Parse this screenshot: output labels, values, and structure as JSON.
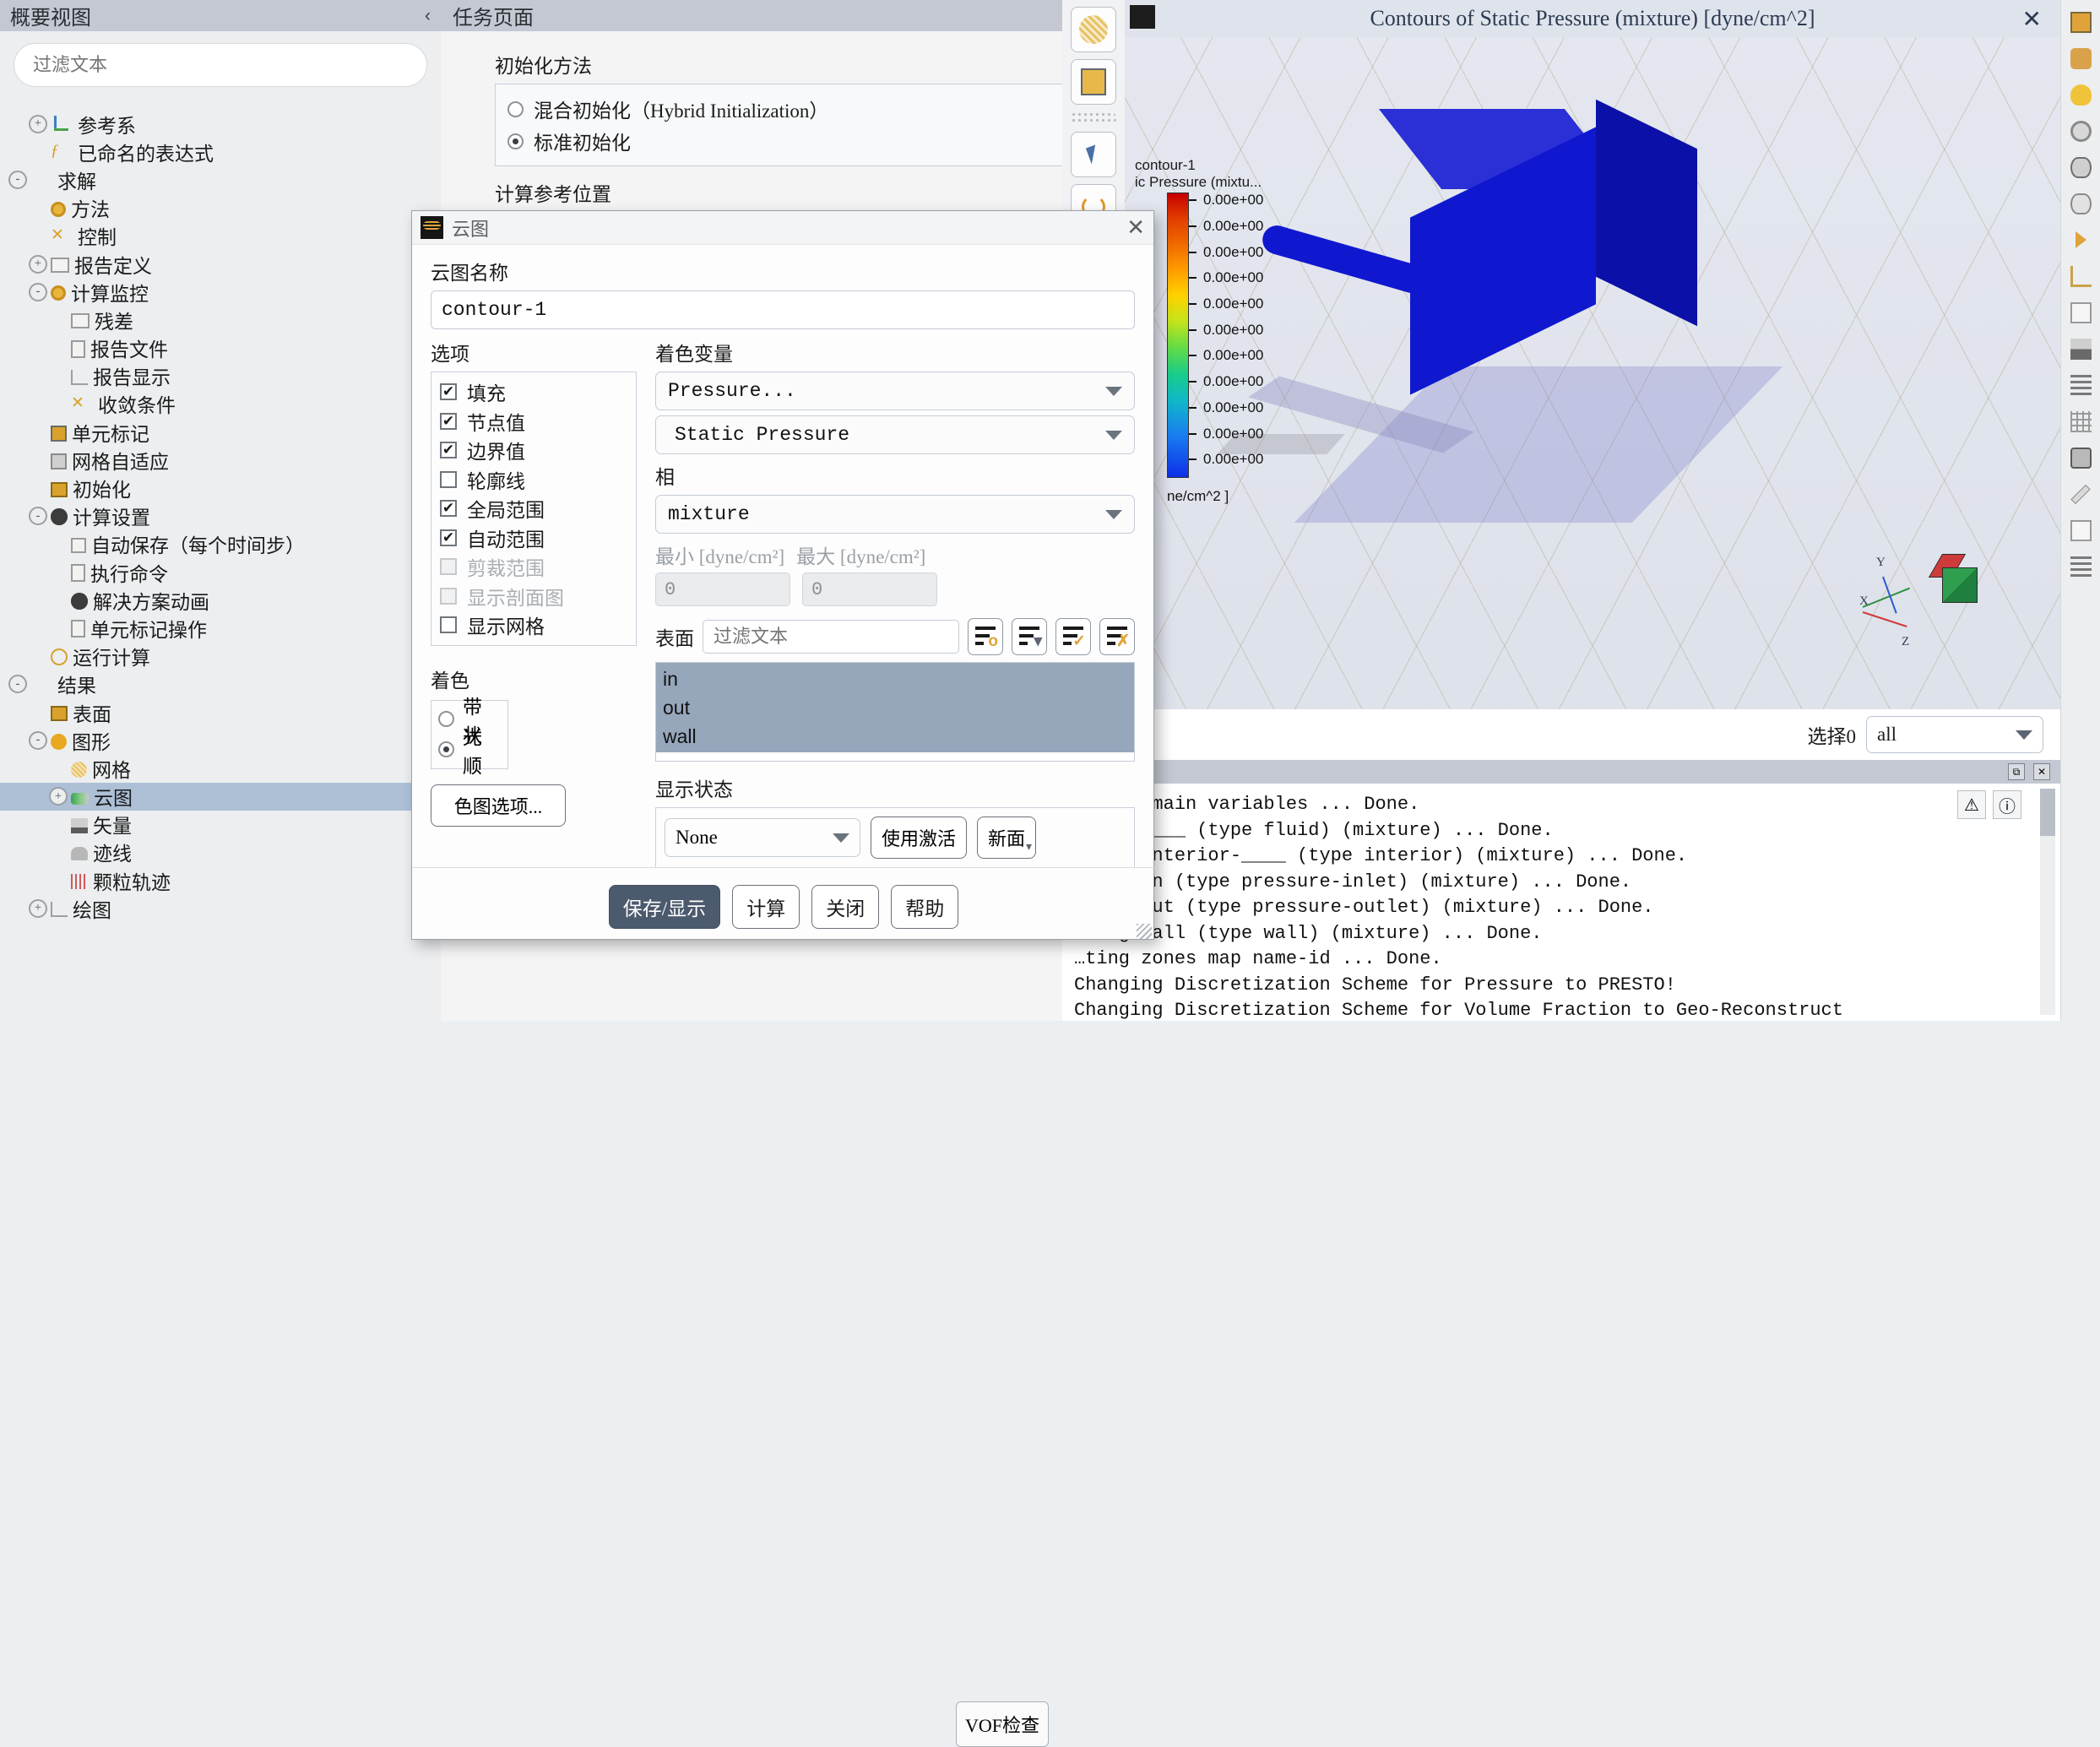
{
  "sidebar": {
    "header_title": "概要视图",
    "collapse_icon": "‹",
    "filter_placeholder": "过滤文本",
    "tree": [
      {
        "label": "参考系",
        "indent": 1,
        "twist": "+",
        "icon": "axes-icon",
        "sel": false
      },
      {
        "label": "已命名的表达式",
        "indent": 1,
        "twist": "",
        "icon": "function-icon",
        "sel": false
      },
      {
        "label": "求解",
        "indent": 0,
        "twist": "-",
        "icon": "",
        "sel": false
      },
      {
        "label": "方法",
        "indent": 1,
        "twist": "",
        "icon": "methods-icon",
        "sel": false
      },
      {
        "label": "控制",
        "indent": 1,
        "twist": "",
        "icon": "controls-icon",
        "sel": false
      },
      {
        "label": "报告定义",
        "indent": 1,
        "twist": "+",
        "icon": "report-definition-icon",
        "sel": false
      },
      {
        "label": "计算监控",
        "indent": 1,
        "twist": "-",
        "icon": "monitor-icon",
        "sel": false
      },
      {
        "label": "残差",
        "indent": 2,
        "twist": "",
        "icon": "residual-icon",
        "sel": false
      },
      {
        "label": "报告文件",
        "indent": 2,
        "twist": "",
        "icon": "report-file-icon",
        "sel": false
      },
      {
        "label": "报告显示",
        "indent": 2,
        "twist": "",
        "icon": "report-plot-icon",
        "sel": false
      },
      {
        "label": "收敛条件",
        "indent": 2,
        "twist": "",
        "icon": "convergence-icon",
        "sel": false
      },
      {
        "label": "单元标记",
        "indent": 1,
        "twist": "",
        "icon": "cell-register-icon",
        "sel": false
      },
      {
        "label": "网格自适应",
        "indent": 1,
        "twist": "",
        "icon": "adapt-icon",
        "sel": false
      },
      {
        "label": "初始化",
        "indent": 1,
        "twist": "",
        "icon": "initialize-icon",
        "sel": false
      },
      {
        "label": "计算设置",
        "indent": 1,
        "twist": "-",
        "icon": "calc-settings-icon",
        "sel": false
      },
      {
        "label": "自动保存（每个时间步）",
        "indent": 2,
        "twist": "",
        "icon": "autosave-icon",
        "sel": false
      },
      {
        "label": "执行命令",
        "indent": 2,
        "twist": "",
        "icon": "execute-command-icon",
        "sel": false
      },
      {
        "label": "解决方案动画",
        "indent": 2,
        "twist": "",
        "icon": "animation-icon",
        "sel": false
      },
      {
        "label": "单元标记操作",
        "indent": 2,
        "twist": "",
        "icon": "cell-register-ops-icon",
        "sel": false
      },
      {
        "label": "运行计算",
        "indent": 1,
        "twist": "",
        "icon": "run-calculation-icon",
        "sel": false
      },
      {
        "label": "结果",
        "indent": 0,
        "twist": "-",
        "icon": "",
        "sel": false
      },
      {
        "label": "表面",
        "indent": 1,
        "twist": "",
        "icon": "surfaces-icon",
        "sel": false
      },
      {
        "label": "图形",
        "indent": 1,
        "twist": "-",
        "icon": "graphics-icon",
        "sel": false
      },
      {
        "label": "网格",
        "indent": 2,
        "twist": "",
        "icon": "mesh-icon",
        "sel": false
      },
      {
        "label": "云图",
        "indent": 2,
        "twist": "+",
        "icon": "contours-icon",
        "sel": true
      },
      {
        "label": "矢量",
        "indent": 2,
        "twist": "",
        "icon": "vectors-icon",
        "sel": false
      },
      {
        "label": "迹线",
        "indent": 2,
        "twist": "",
        "icon": "pathlines-icon",
        "sel": false
      },
      {
        "label": "颗粒轨迹",
        "indent": 2,
        "twist": "",
        "icon": "particle-tracks-icon",
        "sel": false
      },
      {
        "label": "绘图",
        "indent": 1,
        "twist": "+",
        "icon": "plots-icon",
        "sel": false
      }
    ]
  },
  "taskpage": {
    "header_title": "任务页面",
    "collapse_icon": "‹",
    "init_method_label": "初始化方法",
    "init_options": [
      {
        "label": "混合初始化（Hybrid Initialization）",
        "selected": false
      },
      {
        "label": "标准初始化",
        "selected": true
      }
    ],
    "reference_label": "计算参考位置",
    "reference_value": "",
    "vof_check_label": "VOF检查"
  },
  "dialog": {
    "title": "云图",
    "close_icon": "✕",
    "name_label": "云图名称",
    "name_value": "contour-1",
    "options_label": "选项",
    "options": [
      {
        "label": "填充",
        "checked": true,
        "disabled": false
      },
      {
        "label": "节点值",
        "checked": true,
        "disabled": false
      },
      {
        "label": "边界值",
        "checked": true,
        "disabled": false
      },
      {
        "label": "轮廓线",
        "checked": false,
        "disabled": false
      },
      {
        "label": "全局范围",
        "checked": true,
        "disabled": false
      },
      {
        "label": "自动范围",
        "checked": true,
        "disabled": false
      },
      {
        "label": "剪裁范围",
        "checked": false,
        "disabled": true
      },
      {
        "label": "显示剖面图",
        "checked": false,
        "disabled": true
      },
      {
        "label": "显示网格",
        "checked": false,
        "disabled": false
      }
    ],
    "coloring_label": "着色",
    "coloring_options": [
      {
        "label": "带状",
        "selected": false
      },
      {
        "label": "光顺",
        "selected": true
      }
    ],
    "colormap_button": "色图选项...",
    "color_by_label": "着色变量",
    "color_by_value": "Pressure...",
    "color_by_sub_value": "Static Pressure",
    "phase_label": "相",
    "phase_value": "mixture",
    "min_label": "最小 [dyne/cm²]",
    "max_label": "最大 [dyne/cm²]",
    "min_value": "0",
    "max_value": "0",
    "surfaces_label": "表面",
    "surfaces_filter_placeholder": "过滤文本",
    "surface_buttons": [
      "match-surfaces-icon",
      "select-filter-icon",
      "select-all-icon",
      "deselect-all-icon"
    ],
    "surfaces": [
      "in",
      "out",
      "wall"
    ],
    "display_state_label": "显示状态",
    "display_state_value": "None",
    "use_active_button": "使用激活",
    "new_surface_button": "新面",
    "buttons": [
      {
        "label": "保存/显示",
        "primary": true
      },
      {
        "label": "计算",
        "primary": false
      },
      {
        "label": "关闭",
        "primary": false
      },
      {
        "label": "帮助",
        "primary": false
      }
    ]
  },
  "viewport": {
    "title": "Contours of Static Pressure (mixture)  [dyne/cm^2]",
    "close_icon": "✕",
    "legend_name": "contour-1",
    "legend_variable": "ic Pressure (mixtu...",
    "legend_unit": "ne/cm^2 ]",
    "legend_ticks": [
      "0.00e+00",
      "0.00e+00",
      "0.00e+00",
      "0.00e+00",
      "0.00e+00",
      "0.00e+00",
      "0.00e+00",
      "0.00e+00",
      "0.00e+00",
      "0.00e+00",
      "0.00e+00"
    ],
    "axis_labels": [
      "X",
      "Y",
      "Z"
    ],
    "select_label": "选择0",
    "select_value": "all"
  },
  "console": {
    "lines": [
      "…ing domain variables ... Done.",
      "…ting ____ (type fluid) (mixture) ... Done.",
      "…ting interior-____ (type interior) (mixture) ... Done.",
      "…ting in (type pressure-inlet) (mixture) ... Done.",
      "…ting out (type pressure-outlet) (mixture) ... Done.",
      "…ting wall (type wall) (mixture) ... Done.",
      "…ting zones map name-id ... Done.",
      "Changing Discretization Scheme for Pressure to PRESTO!",
      "Changing Discretization Scheme for Volume Fraction to Geo-Reconstruct"
    ],
    "warning_icon": "⚠",
    "info_icon": "ⓘ"
  },
  "minitoolbar": {
    "items": [
      "mesh-display-icon",
      "copy-view-icon",
      "dots-handle-icon",
      "pointer-select-icon",
      "rotate-view-icon"
    ]
  },
  "rail": {
    "items": [
      "book-icon",
      "hand-icon",
      "bulb-icon",
      "sun-icon",
      "eye-icon",
      "eye-hidden-icon",
      "arrow-icon",
      "curve-icon",
      "doc-icon",
      "chart-icon",
      "list-icon",
      "grid-icon",
      "camera-icon",
      "pen-icon",
      "panel-icon",
      "layers-icon"
    ]
  },
  "colors": {
    "accent": "#4c5a6e",
    "selection": "#96a7bb",
    "tree_selection": "#adc0d6",
    "header_bar": "#c3c8d2",
    "geometry_blue": "#1018cf"
  }
}
